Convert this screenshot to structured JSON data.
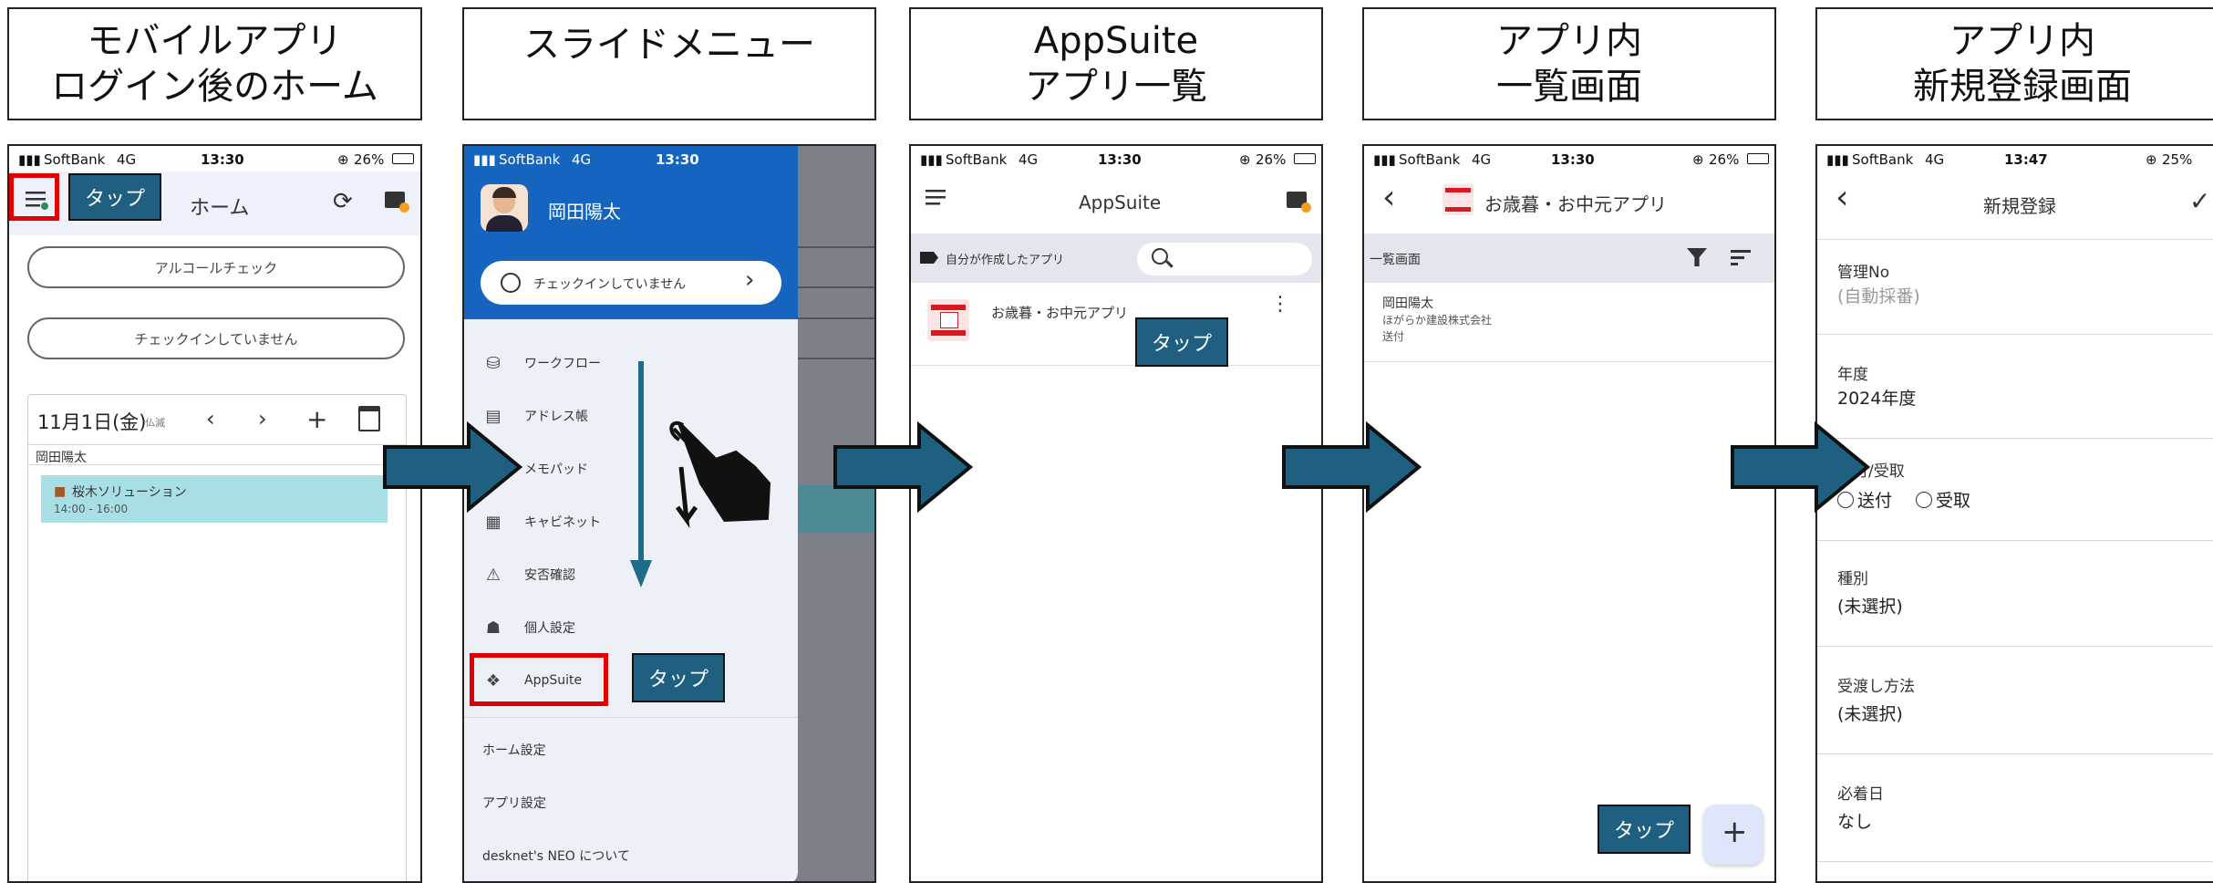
{
  "panels": [
    {
      "title_l1": "モバイルアプリ",
      "title_l2": "ログイン後のホーム"
    },
    {
      "title_l1": "スライドメニュー",
      "title_l2": ""
    },
    {
      "title_l1": "AppSuite",
      "title_l2": "アプリ一覧"
    },
    {
      "title_l1": "アプリ内",
      "title_l2": "一覧画面"
    },
    {
      "title_l1": "アプリ内",
      "title_l2": "新規登録画面"
    }
  ],
  "status": {
    "carrier": "SoftBank",
    "network": "4G",
    "time_1": "13:30",
    "time_2": "13:47",
    "battery_1": "26%",
    "battery_2": "25%"
  },
  "callout": {
    "tap": "タップ"
  },
  "home": {
    "title": "ホーム",
    "alcohol_check": "アルコールチェック",
    "checkin": "チェックインしていません",
    "date": "11月1日(金)",
    "date_note": "仏滅",
    "user": "岡田陽太",
    "event_title": "桜木ソリューション",
    "event_time": "14:00 - 16:00"
  },
  "slide_menu": {
    "user": "岡田陽太",
    "checkin": "チェックインしていません",
    "items": [
      "ワークフロー",
      "アドレス帳",
      "メモパッド",
      "キャビネット",
      "安否確認",
      "個人設定",
      "AppSuite"
    ],
    "footer": [
      "ホーム設定",
      "アプリ設定",
      "desknet's NEO について"
    ]
  },
  "appsuite": {
    "title": "AppSuite",
    "filter_label": "自分が作成したアプリ",
    "app_name": "お歳暮・お中元アプリ"
  },
  "app_list": {
    "title": "お歳暮・お中元アプリ",
    "view_label": "一覧画面",
    "record_name": "岡田陽太",
    "record_company": "ほがらか建設株式会社",
    "record_type": "送付"
  },
  "new_record": {
    "title": "新規登録",
    "fields": [
      {
        "label": "管理No",
        "value": "(自動採番)"
      },
      {
        "label": "年度",
        "value": "2024年度"
      },
      {
        "label": "送付/受取",
        "value": ""
      },
      {
        "label": "種別",
        "value": "(未選択)"
      },
      {
        "label": "受渡し方法",
        "value": "(未選択)"
      },
      {
        "label": "必着日",
        "value": "なし"
      }
    ],
    "radio_1": "送付",
    "radio_2": "受取"
  },
  "colors": {
    "accent_blue": "#1565c0",
    "callout": "#1f5f80",
    "highlight": "#e00000",
    "event_bg": "#a8dfe6"
  }
}
